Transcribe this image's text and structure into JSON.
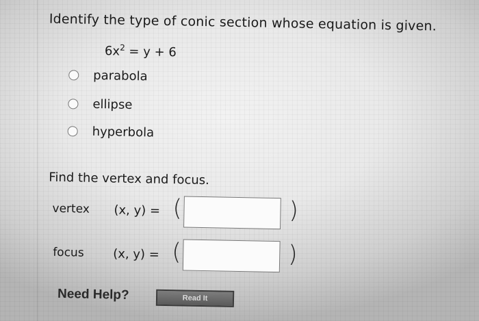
{
  "question": {
    "prompt": "Identify the type of conic section whose equation is given.",
    "equation_lhs": "6x",
    "equation_exp": "2",
    "equation_rhs": " = y + 6",
    "options": [
      {
        "label": "parabola"
      },
      {
        "label": "ellipse"
      },
      {
        "label": "hyperbola"
      }
    ]
  },
  "second_part": {
    "prompt": "Find the vertex and focus.",
    "rows": [
      {
        "label": "vertex",
        "coords": "(x, y)  =",
        "value": ""
      },
      {
        "label": "focus",
        "coords": "(x, y)  =",
        "value": ""
      }
    ]
  },
  "help": {
    "label": "Need Help?",
    "button": "Read It"
  },
  "colors": {
    "background": "#e9e9e9",
    "text": "#1a1a1a",
    "button_bg": "#6a6a6a"
  }
}
